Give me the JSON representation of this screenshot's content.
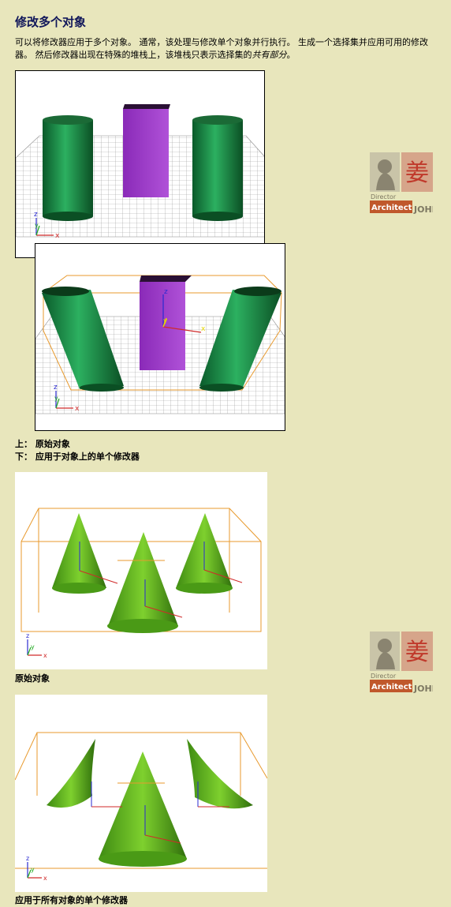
{
  "title": "修改多个对象",
  "intro": {
    "text": "可以将修改器应用于多个对象。 通常，该处理与修改单个对象并行执行。 生成一个选择集并应用可用的修改器。 然后修改器出现在特殊的堆栈上，该堆栈只表示选择集的",
    "emphasis": "共有部分",
    "end": "。"
  },
  "captions": {
    "top_line": "上：  原始对象",
    "bottom_line": "下：  应用于对象上的单个修改器",
    "cones_original": "原始对象",
    "cones_modified": "应用于所有对象的单个修改器"
  },
  "axis_labels": {
    "x": "x",
    "y": "y",
    "z": "z"
  },
  "watermark": {
    "name": "姜",
    "director": "Director",
    "architect": "Architect",
    "john": "JOHN"
  },
  "colors": {
    "background": "#e8e6bc",
    "title": "#11175a",
    "cylinder_green": "#1f8f4a",
    "box_purple": "#9b38c9",
    "cone_green": "#5dbb1e",
    "bbox_orange": "#e89a2e",
    "logo_red": "#c0392b"
  }
}
